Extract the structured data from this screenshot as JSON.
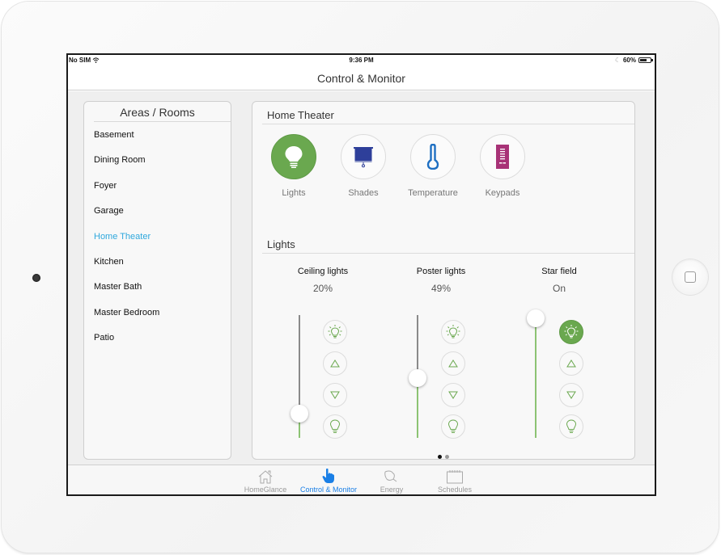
{
  "status_bar": {
    "carrier": "No SIM",
    "time": "9:36 PM",
    "battery": "60%"
  },
  "nav": {
    "title": "Control & Monitor"
  },
  "rooms": {
    "header": "Areas / Rooms",
    "items": [
      {
        "label": "Basement"
      },
      {
        "label": "Dining Room"
      },
      {
        "label": "Foyer"
      },
      {
        "label": "Garage"
      },
      {
        "label": "Home Theater",
        "active": true
      },
      {
        "label": "Kitchen"
      },
      {
        "label": "Master Bath"
      },
      {
        "label": "Master Bedroom"
      },
      {
        "label": "Patio"
      }
    ]
  },
  "main": {
    "room_title": "Home Theater",
    "categories": [
      {
        "label": "Lights",
        "icon": "lightbulb-icon",
        "active": true
      },
      {
        "label": "Shades",
        "icon": "shade-icon"
      },
      {
        "label": "Temperature",
        "icon": "thermometer-icon"
      },
      {
        "label": "Keypads",
        "icon": "keypad-icon"
      }
    ],
    "section_title": "Lights",
    "devices": [
      {
        "name": "Ceiling lights",
        "value": "20%",
        "level": 0.2,
        "on_active": false
      },
      {
        "name": "Poster lights",
        "value": "49%",
        "level": 0.49,
        "on_active": false
      },
      {
        "name": "Star field",
        "value": "On",
        "level": 1.0,
        "on_active": true
      }
    ],
    "pages": {
      "count": 2,
      "current": 1
    }
  },
  "tabbar": {
    "tabs": [
      {
        "label": "HomeGlance",
        "icon": "house-icon"
      },
      {
        "label": "Control & Monitor",
        "icon": "hand-pointer-icon",
        "active": true
      },
      {
        "label": "Energy",
        "icon": "energy-icon"
      },
      {
        "label": "Schedules",
        "icon": "calendar-icon"
      }
    ]
  },
  "colors": {
    "accent_green": "#6aa84f",
    "active_blue": "#1a7fe6",
    "room_active": "#2fa8dd",
    "shade_blue": "#2e3f9a",
    "thermo_blue": "#1e6fc2",
    "keypad_magenta": "#a83277"
  }
}
